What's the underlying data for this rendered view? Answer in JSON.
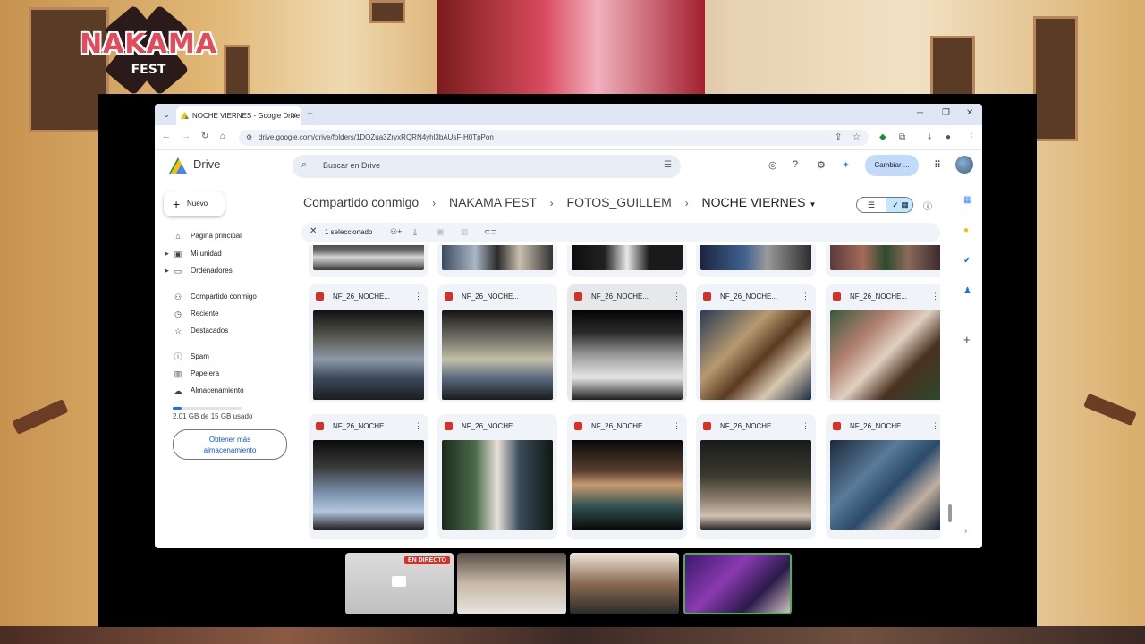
{
  "overlay": {
    "logo_text": "NAKAMA",
    "logo_sub": "FEST",
    "live_badge": "EN DIRECTO"
  },
  "browser": {
    "tab_title": "NOCHE VIERNES - Google Drive",
    "tab_close": "✕",
    "new_tab": "+",
    "url": "drive.google.com/drive/folders/1DOZua3ZryxRQRN4yhl3bAUsF-H0TpPon",
    "win_min": "─",
    "win_max": "❐",
    "win_close": "✕"
  },
  "drive": {
    "title": "Drive",
    "search_placeholder": "Buscar en Drive",
    "cambiar_label": "Cambiar ...",
    "new_label": "Nuevo"
  },
  "sidebar": {
    "items": [
      {
        "label": "Página principal",
        "icon": "home-icon"
      },
      {
        "label": "Mi unidad",
        "icon": "drive-icon"
      },
      {
        "label": "Ordenadores",
        "icon": "computer-icon"
      },
      {
        "label": "Compartido conmigo",
        "icon": "shared-icon"
      },
      {
        "label": "Reciente",
        "icon": "clock-icon"
      },
      {
        "label": "Destacados",
        "icon": "star-icon"
      },
      {
        "label": "Spam",
        "icon": "spam-icon"
      },
      {
        "label": "Papelera",
        "icon": "trash-icon"
      },
      {
        "label": "Almacenamiento",
        "icon": "cloud-icon"
      }
    ],
    "storage_text": "2,01 GB de 15 GB usado",
    "storage_used_fraction": 0.134,
    "get_storage_line1": "Obtener más",
    "get_storage_line2": "almacenamiento"
  },
  "breadcrumb": {
    "items": [
      "Compartido conmigo",
      "NAKAMA FEST",
      "FOTOS_GUILLEM"
    ],
    "current": "NOCHE VIERNES",
    "separator": "›"
  },
  "selection": {
    "text": "1 seleccionado"
  },
  "files": {
    "name": "NF_26_NOCHE...",
    "count_row1": 5,
    "count_row2": 5
  },
  "colors": {
    "accent": "#1a73e8",
    "selected_toggle": "#c2e7ff",
    "pdf_red": "#d93025",
    "cambiar_bg": "#c2dbfb"
  }
}
